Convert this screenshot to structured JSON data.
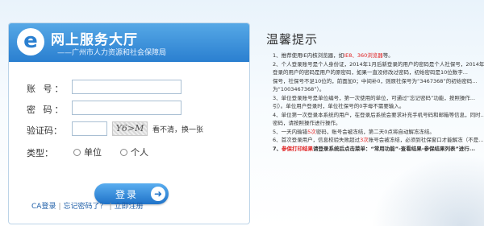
{
  "header": {
    "logo_letter": "e",
    "title": "网上服务大厅",
    "subtitle": "——广州市人力资源和社会保障局"
  },
  "form": {
    "account_label": "账 号：",
    "password_label": "密 码：",
    "captcha_label": "验证码：",
    "captcha_image_text": "Y6>M",
    "captcha_refresh": "看不清，换一张",
    "type_label": "类型：",
    "type_options": [
      "单位",
      "个人"
    ],
    "login_button": "登录",
    "account_value": "",
    "password_value": "",
    "captcha_value": ""
  },
  "links": {
    "ca_login": "CA登录",
    "forgot_password": "忘记密码了？",
    "register": "立即注册",
    "separator": "|"
  },
  "notice": {
    "title": "温馨提示",
    "items": [
      {
        "pre": "1、推荐使用IE内核浏览器，如",
        "red": "IE8、360浏览器",
        "post": "等。",
        "bold": false
      },
      {
        "pre": "2、个人登录账号是个人身份证，2014年1月后新登录的用户的密码是个人社保号，2014年...",
        "red": "",
        "post": "",
        "bold": false
      },
      {
        "pre": "登录的用户的密码是用户的原密码，如果一直没修改过密码，初始密码是10位数字...",
        "red": "",
        "post": "",
        "bold": false
      },
      {
        "pre": "保号，社保号不足10位的，前面加0；中间补0，则原社保号为“3467368”的初始密码...",
        "red": "",
        "post": "",
        "bold": false
      },
      {
        "pre": "为“1003467368”）。",
        "red": "",
        "post": "",
        "bold": false
      },
      {
        "pre": "3、单位登录账号是单位编号，第一次使用的单位，可通过“忘记密码”功能，按照操作...",
        "red": "",
        "post": "",
        "bold": false
      },
      {
        "pre": "引）。单位用户登录时，单位社保号的0字母不需要输入。",
        "red": "",
        "post": "",
        "bold": false
      },
      {
        "pre": "4、单位第一次登录本系统的用户，在登录后系统会要求补充手机号码和邮箱等信息，同时...",
        "red": "",
        "post": "",
        "bold": false
      },
      {
        "pre": "密码，请按照操作进行操作。",
        "red": "",
        "post": "",
        "bold": false
      },
      {
        "pre": "5、一天内输错",
        "red": "5次",
        "post": "密码，账号会被冻结，第二天0点将自动解冻冻结。",
        "bold": false
      },
      {
        "pre": "6、首次登录用户，信息校验失败超过",
        "red": "3次",
        "post": "账号会被冻结，必须到社保窗口才能解冻（不是...",
        "bold": false
      },
      {
        "pre": "7、",
        "red": "参保打印结果",
        "post": "请登录系统后点击菜单：“常用功能”-查看结果-参保结果列表”进行...",
        "bold": true
      }
    ]
  },
  "colors": {
    "header_blue": "#2a7fd0",
    "link_blue": "#1f5fa8",
    "alert_red": "#e02020"
  }
}
